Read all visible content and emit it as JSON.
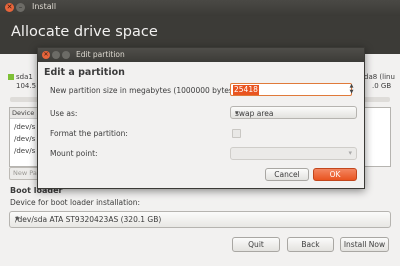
{
  "window": {
    "title": "Install",
    "controls": {
      "close": "✕",
      "minimize": "–"
    }
  },
  "page": {
    "title": "Allocate drive space"
  },
  "background": {
    "left_partition_label": "sda1",
    "left_partition_size": "104.5",
    "right_partition_label": "da8 (linu",
    "right_partition_size": ".0 GB",
    "table_header": "Device",
    "rows": [
      "/dev/s",
      "/dev/s",
      "/dev/s"
    ],
    "new_partition_button": "New Pa"
  },
  "bootloader": {
    "heading": "Boot loader",
    "device_label": "Device for boot loader installation:",
    "device_value": "/dev/sda ATA ST9320423AS (320.1 GB)"
  },
  "buttons": {
    "quit": "Quit",
    "back": "Back",
    "install_now": "Install Now"
  },
  "dialog": {
    "title": "Edit partition",
    "heading": "Edit a partition",
    "size_label": "New partition size in megabytes (1000000 bytes):",
    "size_value": "25418",
    "use_as_label": "Use as:",
    "use_as_value": "swap area",
    "format_label": "Format the partition:",
    "format_checked": false,
    "mount_label": "Mount point:",
    "mount_value": "",
    "cancel_label": "Cancel",
    "ok_label": "OK"
  },
  "colors": {
    "accent": "#e95420",
    "header_bg": "#3c3b37"
  }
}
